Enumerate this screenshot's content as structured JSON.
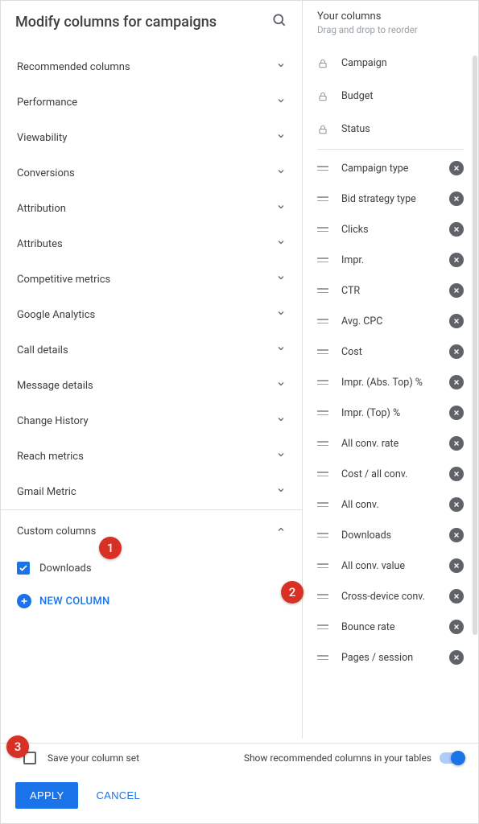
{
  "title": "Modify columns for campaigns",
  "categories": [
    {
      "label": "Recommended columns",
      "expanded": false
    },
    {
      "label": "Performance",
      "expanded": false
    },
    {
      "label": "Viewability",
      "expanded": false
    },
    {
      "label": "Conversions",
      "expanded": false
    },
    {
      "label": "Attribution",
      "expanded": false
    },
    {
      "label": "Attributes",
      "expanded": false
    },
    {
      "label": "Competitive metrics",
      "expanded": false
    },
    {
      "label": "Google Analytics",
      "expanded": false
    },
    {
      "label": "Call details",
      "expanded": false
    },
    {
      "label": "Message details",
      "expanded": false
    },
    {
      "label": "Change History",
      "expanded": false
    },
    {
      "label": "Reach metrics",
      "expanded": false
    },
    {
      "label": "Gmail Metric",
      "expanded": false
    }
  ],
  "custom": {
    "label": "Custom columns",
    "items": [
      {
        "label": "Downloads",
        "checked": true
      }
    ],
    "new_label": "NEW COLUMN"
  },
  "your_columns": {
    "title": "Your columns",
    "subtitle": "Drag and drop to reorder",
    "locked": [
      "Campaign",
      "Budget",
      "Status"
    ],
    "movable": [
      "Campaign type",
      "Bid strategy type",
      "Clicks",
      "Impr.",
      "CTR",
      "Avg. CPC",
      "Cost",
      "Impr. (Abs. Top) %",
      "Impr. (Top) %",
      "All conv. rate",
      "Cost / all conv.",
      "All conv.",
      "Downloads",
      "All conv. value",
      "Cross-device conv.",
      "Bounce rate",
      "Pages / session"
    ]
  },
  "footer": {
    "save_label": "Save your column set",
    "recommended_label": "Show recommended columns in your tables",
    "apply": "APPLY",
    "cancel": "CANCEL"
  },
  "markers": [
    "1",
    "2",
    "3"
  ]
}
